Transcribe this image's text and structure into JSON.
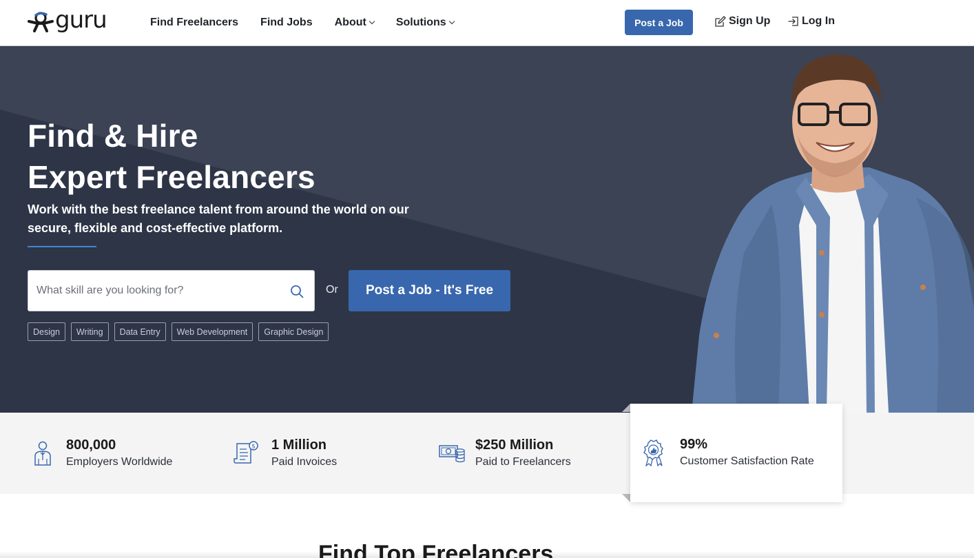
{
  "brand": {
    "name": "guru"
  },
  "nav": {
    "items": [
      {
        "label": "Find Freelancers",
        "dropdown": false
      },
      {
        "label": "Find Jobs",
        "dropdown": false
      },
      {
        "label": "About",
        "dropdown": true
      },
      {
        "label": "Solutions",
        "dropdown": true
      }
    ],
    "post_job": "Post a Job",
    "sign_up": "Sign Up",
    "log_in": "Log In"
  },
  "hero": {
    "title_line1": "Find & Hire",
    "title_line2": "Expert Freelancers",
    "subtitle": "Work with the best freelance talent from around the world on our secure, flexible and cost-effective platform.",
    "search_placeholder": "What skill are you looking for?",
    "or": "Or",
    "cta": "Post a Job - It's Free",
    "tags": [
      "Design",
      "Writing",
      "Data Entry",
      "Web Development",
      "Graphic Design"
    ]
  },
  "stats": [
    {
      "value": "800,000",
      "label": "Employers Worldwide",
      "icon": "employer-icon"
    },
    {
      "value": "1 Million",
      "label": "Paid Invoices",
      "icon": "invoice-icon"
    },
    {
      "value": "$250 Million",
      "label": "Paid to Freelancers",
      "icon": "money-icon"
    },
    {
      "value": "99%",
      "label": "Customer Satisfaction Rate",
      "icon": "award-icon"
    }
  ],
  "section": {
    "title": "Find Top Freelancers"
  },
  "colors": {
    "primary": "#3867ad",
    "hero_bg": "#3b4354",
    "hero_dark": "#2d3446",
    "accent_line": "#3f86d6",
    "stats_bg": "#f4f4f5"
  }
}
